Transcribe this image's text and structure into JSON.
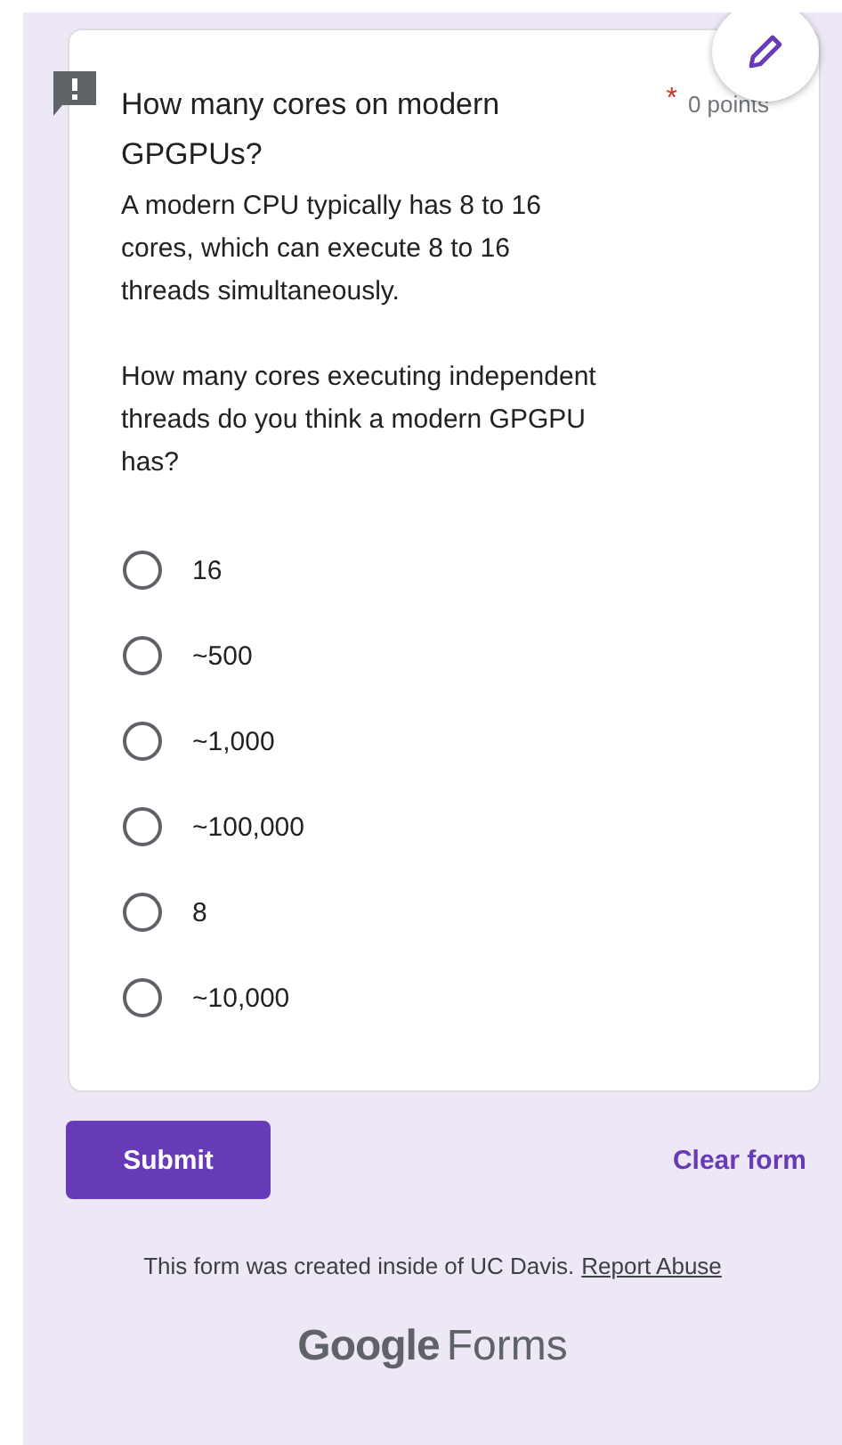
{
  "question": {
    "title": "How many cores on modern GPGPUs?",
    "required": true,
    "required_mark": "*",
    "points": "0 points",
    "description": [
      "A modern CPU typically has 8 to 16 cores, which can execute 8 to 16 threads simultaneously.",
      "How many cores executing independent threads do you think a modern GPGPU has?"
    ],
    "options": [
      {
        "label": "16",
        "selected": false
      },
      {
        "label": "~500",
        "selected": false
      },
      {
        "label": "~1,000",
        "selected": false
      },
      {
        "label": "~100,000",
        "selected": false
      },
      {
        "label": "8",
        "selected": false
      },
      {
        "label": "~10,000",
        "selected": false
      }
    ]
  },
  "submit": "Submit",
  "clear": "Clear form",
  "footer": {
    "text": "This form was created inside of UC Davis.",
    "link": "Report Abuse"
  },
  "brand": {
    "first": "Google",
    "second": "Forms"
  }
}
